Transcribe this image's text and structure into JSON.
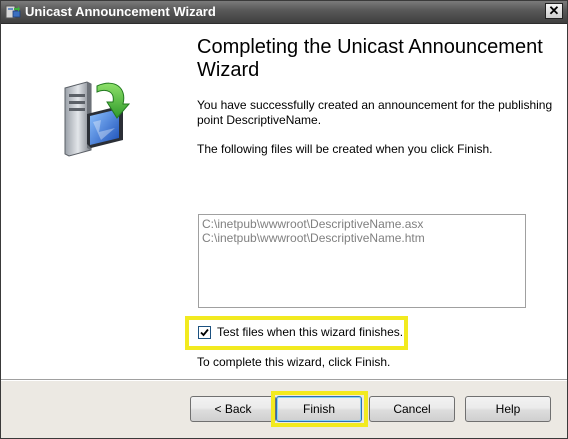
{
  "window": {
    "title": "Unicast Announcement Wizard",
    "close_label": "✕",
    "icon": "wizard-app-icon"
  },
  "hero": {
    "icon": "server-publish-icon"
  },
  "content": {
    "heading": "Completing the Unicast Announcement Wizard",
    "success_message": "You have successfully created an announcement for the publishing point DescriptiveName.",
    "files_intro": "The following files will be created when you click Finish.",
    "files": [
      "C:\\inetpub\\wwwroot\\DescriptiveName.asx",
      "C:\\inetpub\\wwwroot\\DescriptiveName.htm"
    ],
    "test_checkbox": {
      "label": "Test files when this wizard finishes.",
      "checked": true
    },
    "complete_hint": "To complete this wizard, click Finish."
  },
  "buttons": {
    "back": "< Back",
    "finish": "Finish",
    "cancel": "Cancel",
    "help": "Help"
  },
  "colors": {
    "highlight": "#f2ea1f",
    "titlebar": "#4a4a4a"
  }
}
